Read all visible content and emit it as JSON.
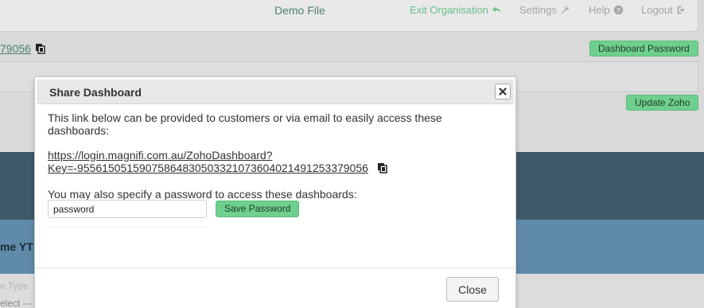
{
  "header": {
    "file_name": "Demo File",
    "nav": {
      "exit_label": "Exit Organisation",
      "settings_label": "Settings",
      "help_label": "Help",
      "logout_label": "Logout"
    }
  },
  "background": {
    "key_fragment": "79056",
    "dashboard_password_button": "Dashboard Password",
    "update_zoho_button": "Update Zoho",
    "band_text": "me YT",
    "lower_text_1": "e Type",
    "lower_text_2": "elect ---"
  },
  "modal": {
    "title": "Share Dashboard",
    "description": "This link below can be provided to customers or via email to easily access these dashboards:",
    "link_line1": "https://login.magnifi.com.au/ZohoDashboard?",
    "link_line2": "Key=-955615051590758648305033210736040214912533790​56",
    "password_label": "You may also specify a password to access these dashboards:",
    "password_value": "password",
    "save_password_button": "Save Password",
    "close_button": "Close"
  },
  "colors": {
    "accent_green": "#6fcf8e",
    "dark_band": "#3e5968",
    "blue_band": "#5f8aa9"
  },
  "icons": [
    "undo-icon",
    "wrench-icon",
    "question-circle-icon",
    "sign-out-icon",
    "copy-icon",
    "close-icon"
  ]
}
